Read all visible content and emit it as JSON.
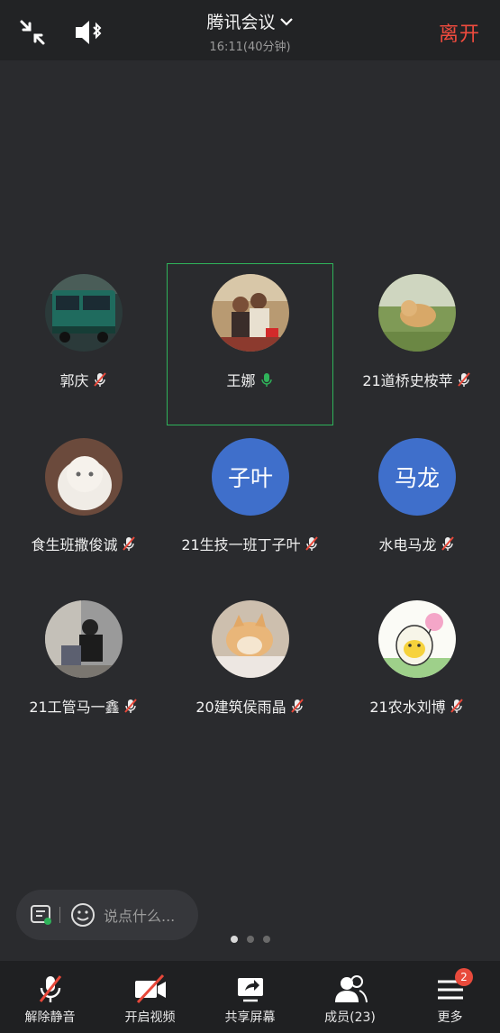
{
  "header": {
    "title": "腾讯会议",
    "subtitle": "16:11(40分钟)",
    "leave_label": "离开"
  },
  "participants": [
    {
      "name": "郭庆",
      "mic": "muted",
      "avatar": "bus-photo"
    },
    {
      "name": "王娜",
      "mic": "speaking",
      "avatar": "family-photo"
    },
    {
      "name": "21道桥史桉苹",
      "mic": "muted",
      "avatar": "dog-on-grass-photo"
    },
    {
      "name": "食生班撒俊诚",
      "mic": "muted",
      "avatar": "white-cat-photo"
    },
    {
      "name": "21生技一班丁子叶",
      "mic": "muted",
      "avatar_text": "子叶"
    },
    {
      "name": "水电马龙",
      "mic": "muted",
      "avatar_text": "马龙"
    },
    {
      "name": "21工管马一鑫",
      "mic": "muted",
      "avatar": "street-people-photo"
    },
    {
      "name": "20建筑侯雨晶",
      "mic": "muted",
      "avatar": "shiba-dog-photo"
    },
    {
      "name": "21农水刘博",
      "mic": "muted",
      "avatar": "cartoon-egg-photo"
    }
  ],
  "chat": {
    "placeholder": "说点什么..."
  },
  "pagination": {
    "pages": 3,
    "current": 1
  },
  "toolbar": {
    "unmute_label": "解除静音",
    "video_label": "开启视频",
    "share_label": "共享屏幕",
    "members_label": "成员(23)",
    "more_label": "更多",
    "more_badge": "2"
  },
  "colors": {
    "leave": "#f04b3e",
    "speaking_border": "#2fb35a",
    "badge": "#e84a3c",
    "text_avatar": "#3f6fcb"
  }
}
